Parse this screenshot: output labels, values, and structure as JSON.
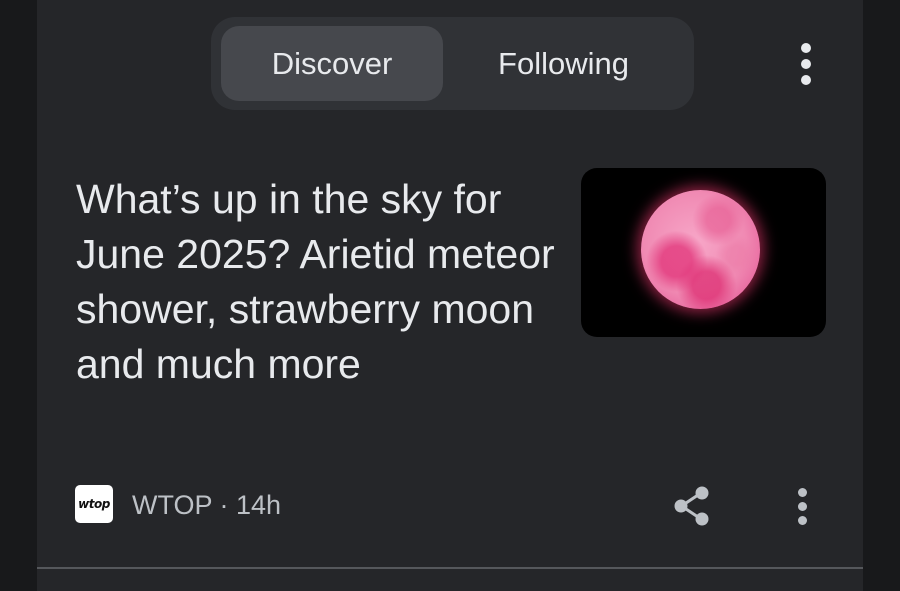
{
  "tabs": {
    "discover_label": "Discover",
    "following_label": "Following",
    "selected": "Discover"
  },
  "article": {
    "headline": "What’s up in the sky for June 2025? Arietid meteor shower, strawberry moon and much more",
    "thumbnail_subject": "pink full moon",
    "source": {
      "logo_text": "wtop",
      "meta": "WTOP · 14h"
    },
    "share_icon": "share-icon",
    "more_icon": "more-vert-icon"
  },
  "header": {
    "menu_icon": "more-vert-icon"
  },
  "colors": {
    "background": "#18191b",
    "card": "#252629",
    "tab_bar": "#303236",
    "tab_selected": "#46484d",
    "text_primary": "#e8eaed",
    "text_secondary": "#bdc1c6"
  }
}
